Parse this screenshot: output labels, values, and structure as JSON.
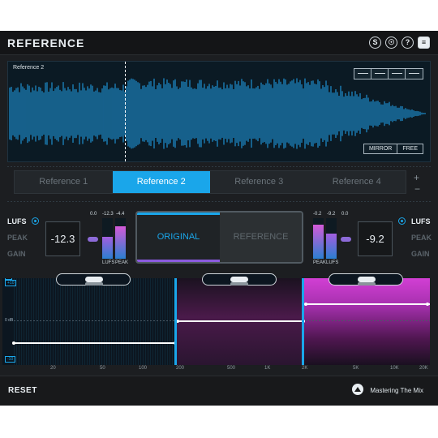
{
  "header": {
    "title": "REFERENCE",
    "icons": [
      "s-icon",
      "lightbulb-icon",
      "help-icon",
      "menu-icon"
    ],
    "s_glyph": "S",
    "bulb_glyph": "☉",
    "help_glyph": "?",
    "menu_glyph": "≡"
  },
  "waveform": {
    "label": "Reference 2",
    "mirror_label": "MIRROR",
    "free_label": "FREE",
    "color": "#1e8fd0"
  },
  "tabs": [
    {
      "label": "Reference 1"
    },
    {
      "label": "Reference 2",
      "active": true
    },
    {
      "label": "Reference 3"
    },
    {
      "label": "Reference 4"
    }
  ],
  "tab_controls": {
    "plus": "+",
    "minus": "−"
  },
  "left": {
    "modes": [
      "LUFS",
      "PEAK",
      "GAIN"
    ],
    "readout": "-12.3",
    "meter_values": [
      "0.0",
      "-12.3",
      "-4.4"
    ],
    "meter_captions": [
      "LUFS",
      "PEAK"
    ],
    "lufs_level": 0.55,
    "peak_level": 0.8
  },
  "compare": {
    "original": "ORIGINAL",
    "reference": "REFERENCE"
  },
  "right": {
    "modes": [
      "LUFS",
      "PEAK",
      "GAIN"
    ],
    "readout": "-9.2",
    "meter_values": [
      "-0.2",
      "-9.2",
      "0.0"
    ],
    "meter_captions": [
      "PEAK",
      "LUFS"
    ],
    "peak_level": 0.85,
    "lufs_level": 0.62
  },
  "eq": {
    "scale_top": "+10",
    "scale_zero": "0 dB",
    "scale_bottom": "-10",
    "scale_small_top": "0",
    "band_colors": [
      "#1aa6ea",
      "#c33ec6"
    ],
    "freq_labels": [
      "20",
      "50",
      "100",
      "200",
      "500",
      "1K",
      "2K",
      "5K",
      "10K",
      "20K"
    ]
  },
  "footer": {
    "reset": "RESET",
    "brand": "Mastering The Mix"
  }
}
